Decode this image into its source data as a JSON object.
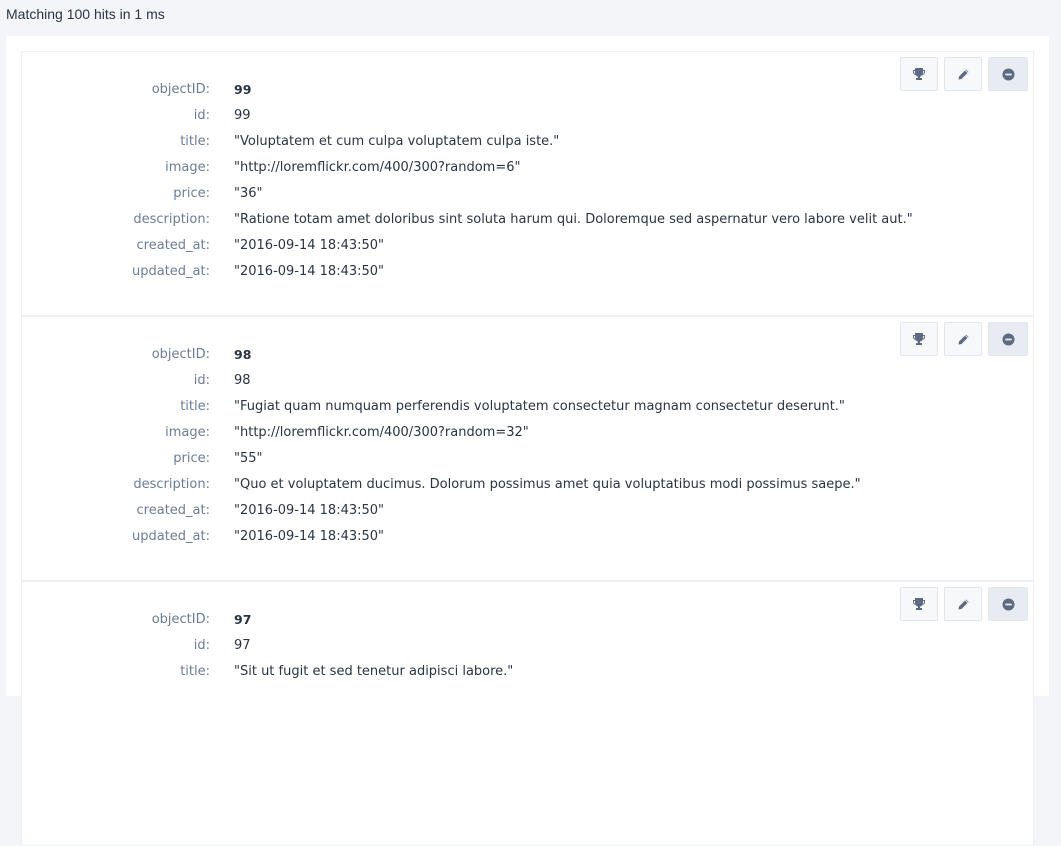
{
  "summary": "Matching 100 hits in 1 ms",
  "labels": {
    "objectID": "objectID:",
    "id": "id:",
    "title": "title:",
    "image": "image:",
    "price": "price:",
    "description": "description:",
    "created_at": "created_at:",
    "updated_at": "updated_at:"
  },
  "icons": {
    "promote": "trophy-icon",
    "edit": "pencil-icon",
    "remove": "minus-circle-icon"
  },
  "colors": {
    "icon": "#5c6b82",
    "key": "#6d7c94",
    "text": "#2b3443"
  },
  "hits": [
    {
      "objectID": "99",
      "id": "99",
      "title": "\"Voluptatem et cum culpa voluptatem culpa iste.\"",
      "image": "\"http://loremflickr.com/400/300?random=6\"",
      "price": "\"36\"",
      "description": "\"Ratione totam amet doloribus sint soluta harum qui. Doloremque sed aspernatur vero labore velit aut.\"",
      "created_at": "\"2016-09-14 18:43:50\"",
      "updated_at": "\"2016-09-14 18:43:50\""
    },
    {
      "objectID": "98",
      "id": "98",
      "title": "\"Fugiat quam numquam perferendis voluptatem consectetur magnam consectetur deserunt.\"",
      "image": "\"http://loremflickr.com/400/300?random=32\"",
      "price": "\"55\"",
      "description": "\"Quo et voluptatem ducimus. Dolorum possimus amet quia voluptatibus modi possimus saepe.\"",
      "created_at": "\"2016-09-14 18:43:50\"",
      "updated_at": "\"2016-09-14 18:43:50\""
    },
    {
      "objectID": "97",
      "id": "97",
      "title": "\"Sit ut fugit et sed tenetur adipisci labore.\""
    }
  ]
}
